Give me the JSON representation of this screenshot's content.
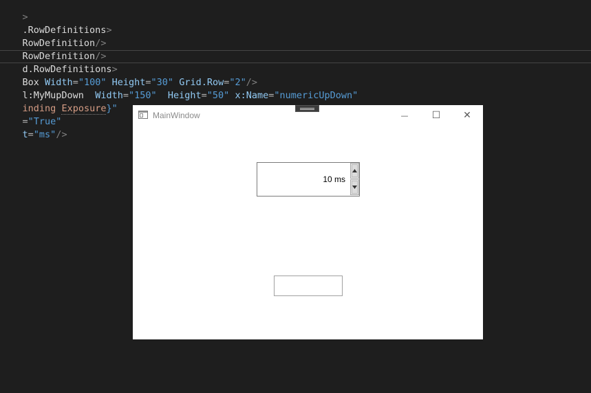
{
  "editor": {
    "lines": [
      {
        "tag": ">"
      },
      {
        "tag": ".RowDefinitions",
        "close": ">"
      },
      {
        "tag": "RowDefinition",
        "close": "/>"
      },
      {
        "tag": "RowDefinition",
        "close": "/>"
      },
      {
        "tag": "d.RowDefinitions",
        "close": ">"
      },
      {
        "tag": "Box",
        "attr1": "Width",
        "val1": "\"100\"",
        "attr2": "Height",
        "val2": "\"30\"",
        "attr3": "Grid.Row",
        "val3": "\"2\"",
        "close": "/>"
      },
      {
        "tag": "l:MyMupDown",
        "attr1": "Width",
        "val1": "\"150\"",
        "attr2": "Height",
        "val2": "\"50\"",
        "attr3": "x:Name",
        "val3": "\"numericUpDown\""
      },
      {
        "part1": "inding",
        "part2": "Exposure",
        "part3": "}\""
      },
      {
        "eq": "=",
        "val": "\"True\""
      },
      {
        "prefix": "t",
        "eq": "=",
        "val": "\"ms\"",
        "close": "/>"
      }
    ]
  },
  "window": {
    "title": "MainWindow",
    "minimize_glyph": "—",
    "maximize_glyph": "☐",
    "close_glyph": "✕"
  },
  "numeric_updown": {
    "value_text": "10 ms"
  },
  "textbox": {
    "value": ""
  },
  "colors": {
    "editor_bg": "#1e1e1e",
    "attribute": "#92caf4",
    "value": "#569cd6",
    "window_bg": "#ffffff"
  }
}
